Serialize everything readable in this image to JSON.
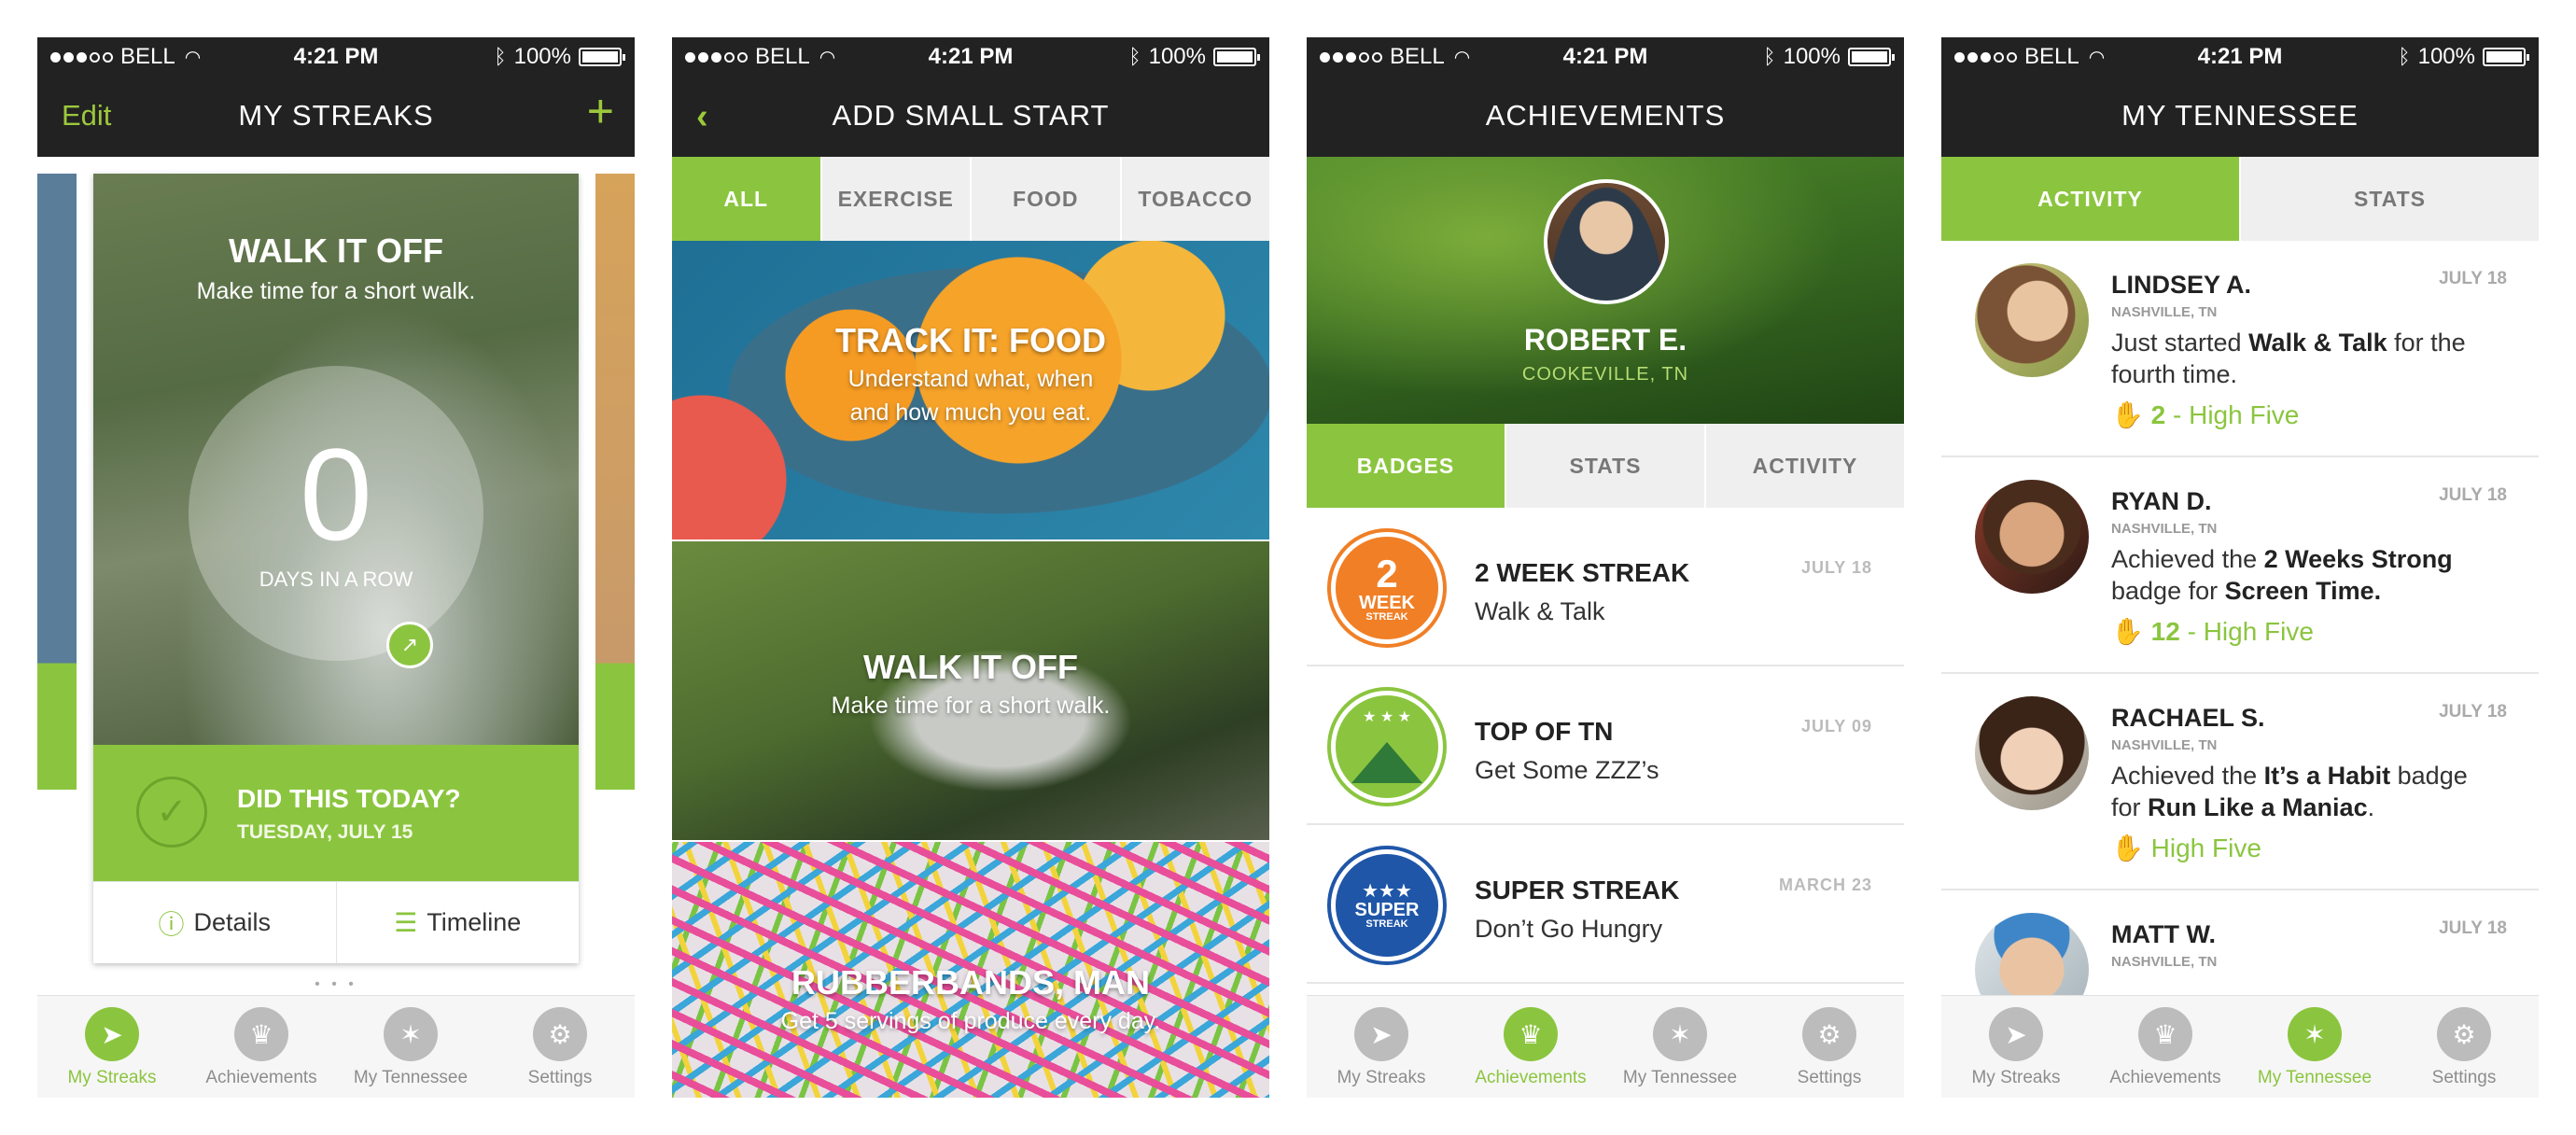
{
  "status": {
    "carrier": "BELL",
    "time": "4:21 PM",
    "battery": "100%"
  },
  "tabs": [
    "My Streaks",
    "Achievements",
    "My Tennessee",
    "Settings"
  ],
  "colors": {
    "accent": "#8bc53f",
    "bar": "#222222"
  },
  "streaks": {
    "edit": "Edit",
    "title": "MY STREAKS",
    "add": "+",
    "card_title": "WALK IT OFF",
    "card_sub": "Make time for a short walk.",
    "count": "0",
    "count_label": "DAYS IN A ROW",
    "did_title": "DID THIS TODAY?",
    "did_date": "TUESDAY, JULY 15",
    "details": "Details",
    "timeline": "Timeline"
  },
  "addstart": {
    "title": "ADD SMALL START",
    "filters": [
      "ALL",
      "EXERCISE",
      "FOOD",
      "TOBACCO"
    ],
    "tiles": [
      {
        "title": "TRACK IT: FOOD",
        "sub1": "Understand what, when",
        "sub2": "and how much you eat."
      },
      {
        "title": "WALK IT OFF",
        "sub1": "Make time for a short walk.",
        "sub2": ""
      },
      {
        "title": "RUBBERBANDS, MAN",
        "sub1": "Get 5 servings of produce every day.",
        "sub2": ""
      }
    ]
  },
  "achievements": {
    "title": "ACHIEVEMENTS",
    "name": "ROBERT E.",
    "location": "COOKEVILLE, TN",
    "segments": [
      "BADGES",
      "STATS",
      "ACTIVITY"
    ],
    "badges": [
      {
        "title": "2 WEEK STREAK",
        "sub": "Walk & Talk",
        "date": "JULY 18",
        "b1": "2",
        "b2": "WEEK",
        "b3": "STREAK"
      },
      {
        "title": "TOP OF TN",
        "sub": "Get Some ZZZ’s",
        "date": "JULY 09"
      },
      {
        "title": "SUPER STREAK",
        "sub": "Don’t Go Hungry",
        "date": "MARCH 23",
        "b1": "★★★",
        "b2": "SUPER",
        "b3": "STREAK"
      }
    ]
  },
  "tennessee": {
    "title": "MY TENNESSEE",
    "segments": [
      "ACTIVITY",
      "STATS"
    ],
    "posts": [
      {
        "name": "LINDSEY A.",
        "loc": "NASHVILLE, TN",
        "date": "JULY 18",
        "pre": "Just started ",
        "bold1": "Walk & Talk",
        "mid": " for the fourth time.",
        "bold2": "",
        "post": "",
        "hf_count": "2",
        "hf": " - High Five"
      },
      {
        "name": "RYAN D.",
        "loc": "NASHVILLE, TN",
        "date": "JULY 18",
        "pre": "Achieved the ",
        "bold1": "2 Weeks Strong",
        "mid": " badge for ",
        "bold2": "Screen Time.",
        "post": "",
        "hf_count": "12",
        "hf": " - High Five"
      },
      {
        "name": "RACHAEL S.",
        "loc": "NASHVILLE, TN",
        "date": "JULY 18",
        "pre": "Achieved the ",
        "bold1": "It’s a Habit",
        "mid": " badge for ",
        "bold2": "Run Like a Maniac",
        "post": ".",
        "hf_count": "",
        "hf": "High Five"
      },
      {
        "name": "MATT W.",
        "loc": "NASHVILLE, TN",
        "date": "JULY 18",
        "pre": "",
        "bold1": "",
        "mid": "",
        "bold2": "",
        "post": "",
        "hf_count": "",
        "hf": ""
      }
    ]
  }
}
